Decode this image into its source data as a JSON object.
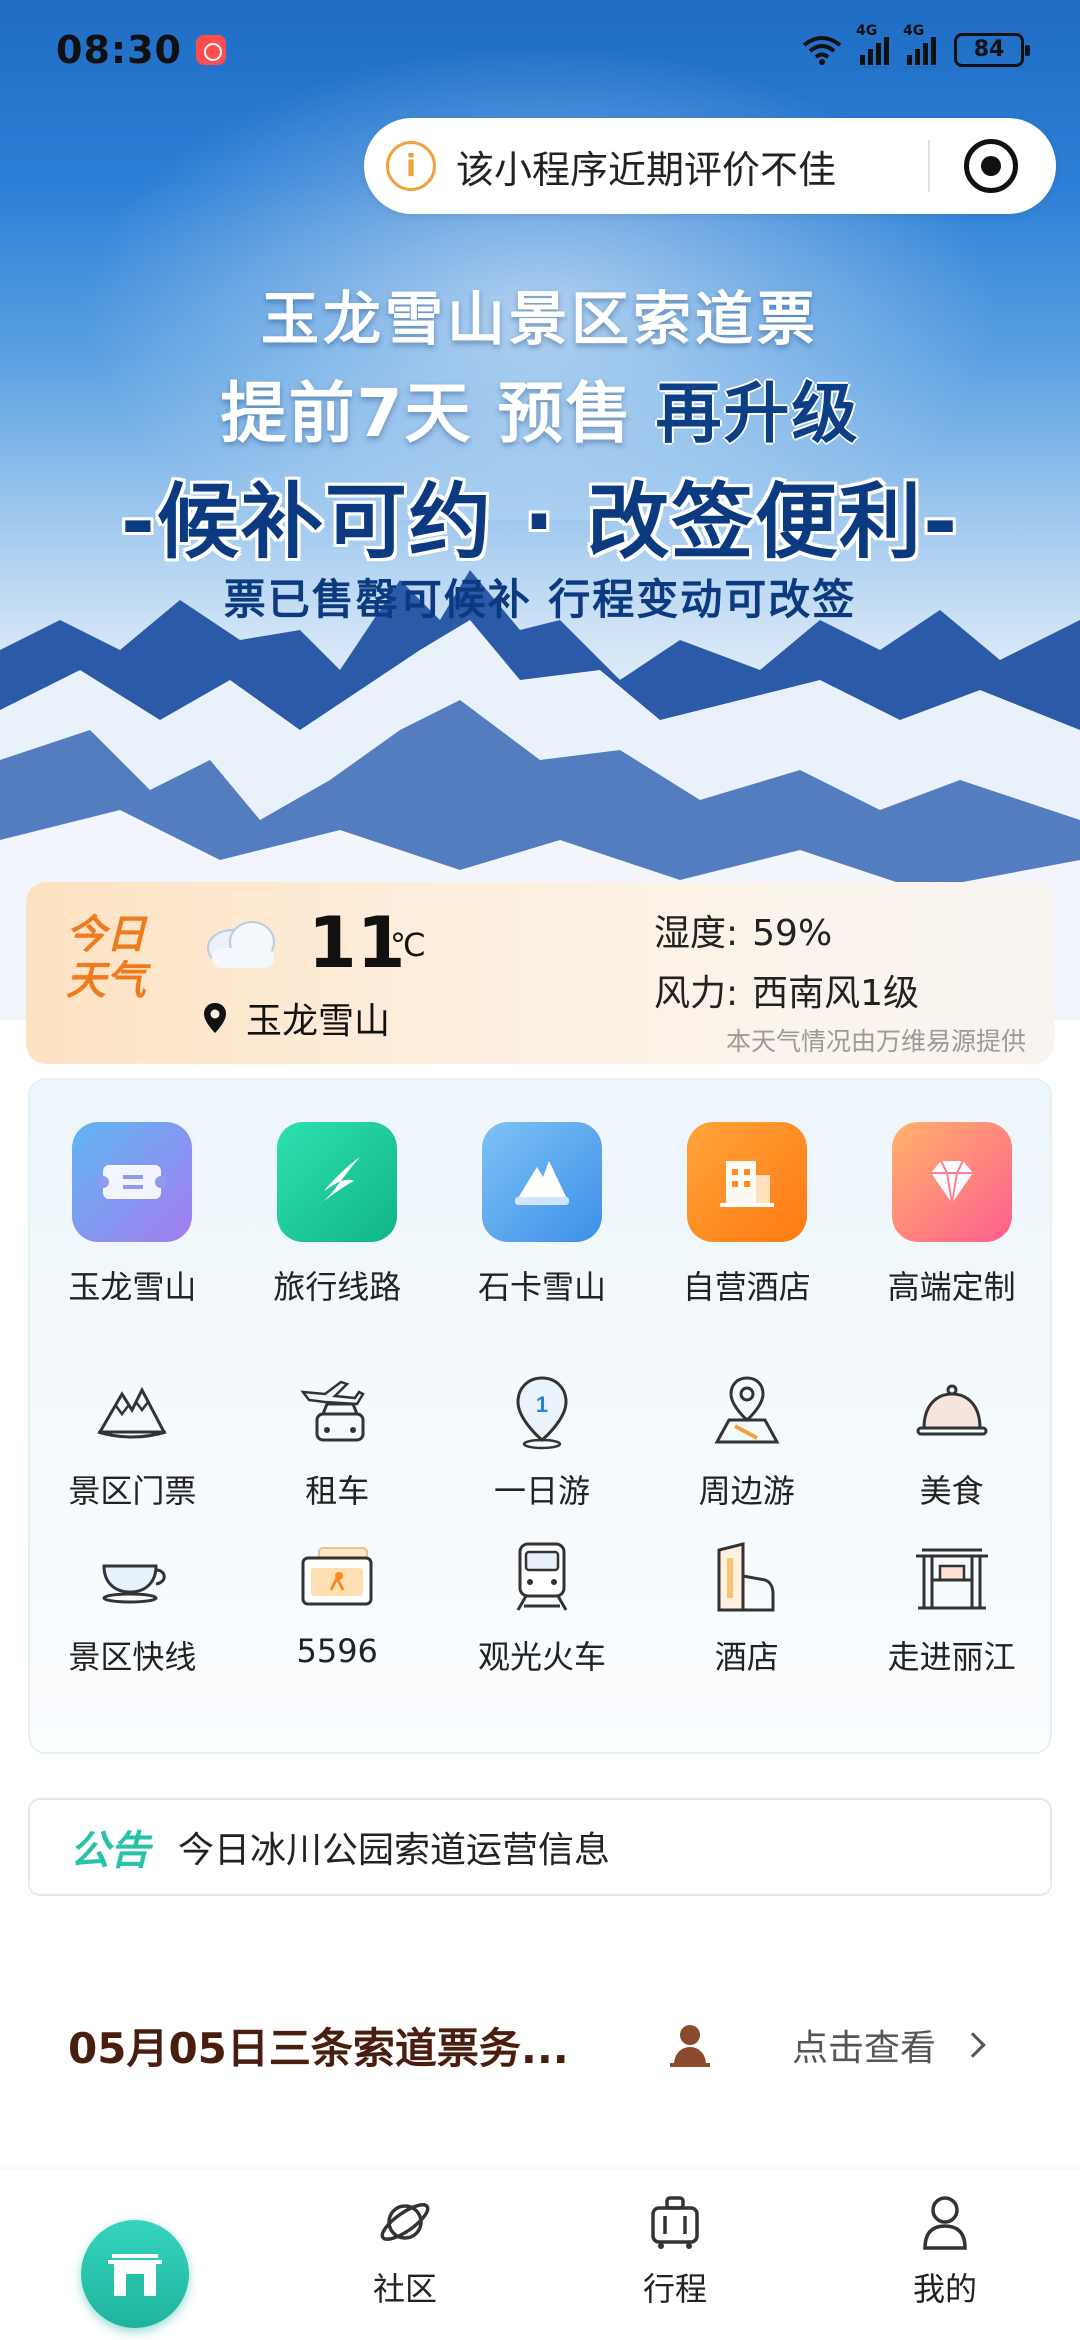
{
  "status_bar": {
    "time": "08:30",
    "network_1": "4G",
    "network_2": "4G",
    "battery": "84"
  },
  "mini_program": {
    "notice": "该小程序近期评价不佳"
  },
  "hero": {
    "line1": "玉龙雪山景区索道票",
    "line2a": "提前7天 预售",
    "line2b": "再升级",
    "line3": "-候补可约 · 改签便利-",
    "line4": "票已售罄可候补  行程变动可改签"
  },
  "weather": {
    "tag_line1": "今日",
    "tag_line2": "天气",
    "temperature": "11",
    "unit": "℃",
    "location": "玉龙雪山",
    "humidity_label": "湿度:",
    "humidity_value": "59%",
    "wind_label": "风力:",
    "wind_value": "西南风1级",
    "source_note": "本天气情况由万维易源提供",
    "condition_icon": "cloud-icon"
  },
  "services": {
    "featured": [
      {
        "label": "玉龙雪山",
        "icon": "ticket-icon",
        "color": "#8f7cf0"
      },
      {
        "label": "旅行线路",
        "icon": "route-icon",
        "color": "#1fc59a"
      },
      {
        "label": "石卡雪山",
        "icon": "snow-mountain-icon",
        "color": "#5aa8f0"
      },
      {
        "label": "自营酒店",
        "icon": "building-icon",
        "color": "#ff8a1f"
      },
      {
        "label": "高端定制",
        "icon": "diamond-icon",
        "color": "#ff6f8e"
      }
    ],
    "row2": [
      {
        "label": "景区门票",
        "icon": "mountain-ticket-icon"
      },
      {
        "label": "租车",
        "icon": "car-plane-icon"
      },
      {
        "label": "一日游",
        "icon": "map-pin-one-icon"
      },
      {
        "label": "周边游",
        "icon": "map-location-icon"
      },
      {
        "label": "美食",
        "icon": "cloche-icon"
      }
    ],
    "row3": [
      {
        "label": "景区快线",
        "icon": "cup-icon"
      },
      {
        "label": "5596",
        "icon": "card-icon"
      },
      {
        "label": "观光火车",
        "icon": "train-icon"
      },
      {
        "label": "酒店",
        "icon": "hotel-icon"
      },
      {
        "label": "走进丽江",
        "icon": "gate-icon"
      }
    ]
  },
  "notice": {
    "tag": "公告",
    "text": "今日冰川公园索道运营信息"
  },
  "news": {
    "title": "05月05日三条索道票务...",
    "link": "点击查看"
  },
  "tabbar": {
    "items": [
      {
        "label": "",
        "icon": "home-gate-icon"
      },
      {
        "label": "社区",
        "icon": "planet-icon"
      },
      {
        "label": "行程",
        "icon": "luggage-icon"
      },
      {
        "label": "我的",
        "icon": "user-icon"
      }
    ],
    "accent": "#1fb39e"
  }
}
